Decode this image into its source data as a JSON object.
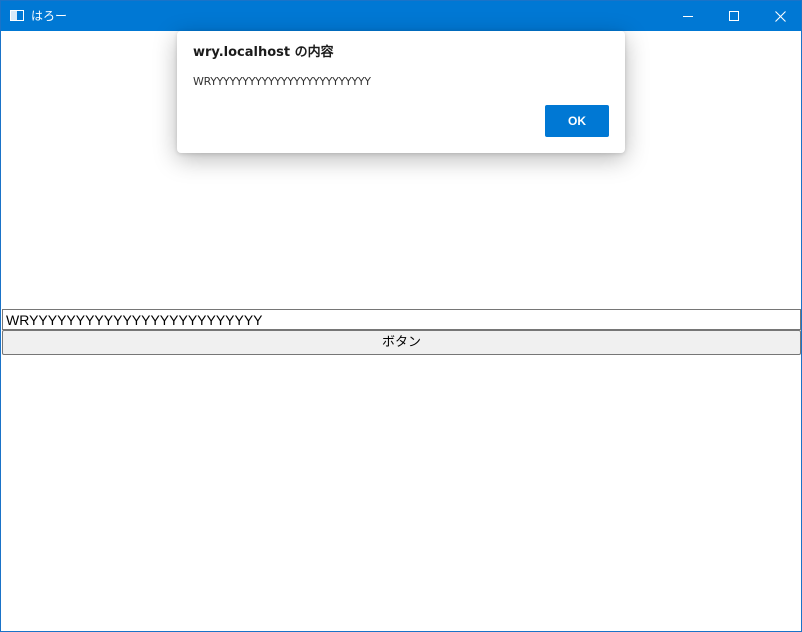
{
  "window": {
    "title": "はろー",
    "icons": {
      "app": "app-window-icon",
      "minimize": "minimize-icon",
      "maximize": "maximize-icon",
      "close": "close-icon"
    }
  },
  "main": {
    "input_value": "WRYYYYYYYYYYYYYYYYYYYYYYYYY",
    "button_label": "ボタン"
  },
  "dialog": {
    "title": "wry.localhost の内容",
    "message": "WRYYYYYYYYYYYYYYYYYYYYYYYYY",
    "ok_label": "OK"
  },
  "colors": {
    "titlebar": "#0078d4",
    "accent": "#0078d4",
    "button_bg": "#f0f0f0"
  }
}
